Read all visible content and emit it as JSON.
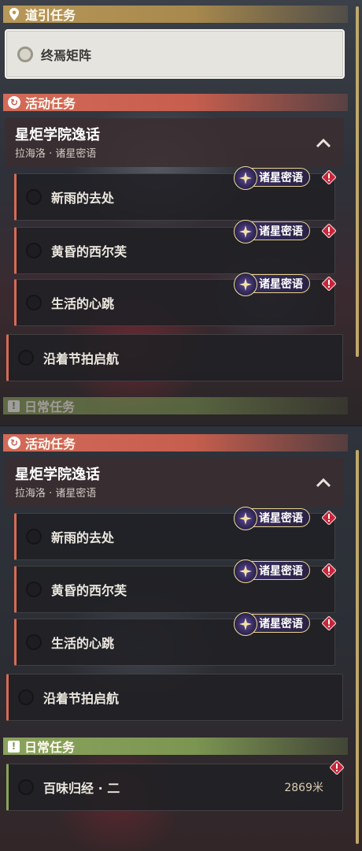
{
  "guide_section": {
    "title": "道引任务",
    "quest": "终焉矩阵"
  },
  "event_section": {
    "title": "活动任务"
  },
  "event_group": {
    "title": "星炬学院逸话",
    "subtitle": "拉海洛 · 诸星密语"
  },
  "event_quests": [
    {
      "label": "新雨的去处",
      "tag": "诸星密语"
    },
    {
      "label": "黄昏的西尔芙",
      "tag": "诸星密语"
    },
    {
      "label": "生活的心跳",
      "tag": "诸星密语"
    }
  ],
  "event_main_quest": {
    "label": "沿着节拍启航"
  },
  "daily_section": {
    "title": "日常任务"
  },
  "daily_quests": [
    {
      "label": "百味归经 · 二",
      "distance": "2869米"
    }
  ],
  "icons": {
    "guide": "map-pin-icon",
    "event": "refresh-icon",
    "daily": "exclamation-icon",
    "collapse": "chevron-up-icon",
    "tag": "star-emblem-icon",
    "alert": "alert-diamond-icon"
  },
  "colors": {
    "guide_accent": "#b89858",
    "event_accent": "#d46a58",
    "daily_accent": "#8aa35d",
    "tag_border": "#e7d28a",
    "alert": "#c8243a"
  }
}
